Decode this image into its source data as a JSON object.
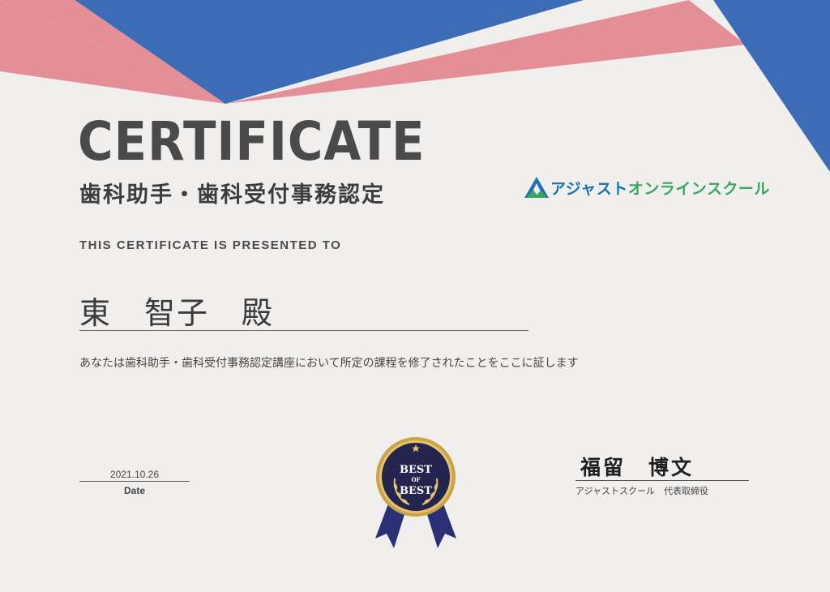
{
  "certificate": {
    "title": "CERTIFICATE",
    "course_title": "歯科助手・歯科受付事務認定",
    "presented_to": "THIS CERTIFICATE IS PRESENTED TO",
    "recipient_name": "東　智子　殿",
    "statement": "あなたは歯科助手・歯科受付事務認定講座において所定の課程を修了されたことをここに証します"
  },
  "logo": {
    "text_part1": "アジャスト",
    "text_part2": "オンラインスクール",
    "icon": "mountain-a-logo-icon",
    "colors": {
      "blue": "#1a73b8",
      "green": "#37a95d"
    }
  },
  "date": {
    "value": "2021.10.26",
    "label": "Date"
  },
  "badge": {
    "line1": "BEST",
    "line2": "OF",
    "line3": "BEST",
    "icon": "award-ribbon-icon"
  },
  "signature": {
    "name": "福留　博文",
    "caption": "アジャストスクール　代表取締役"
  },
  "colors": {
    "background": "#f1efee",
    "blue": "#3d6cb6",
    "pink": "#e48f96",
    "badge_navy": "#23254e",
    "badge_gold": "#c9a24a"
  }
}
